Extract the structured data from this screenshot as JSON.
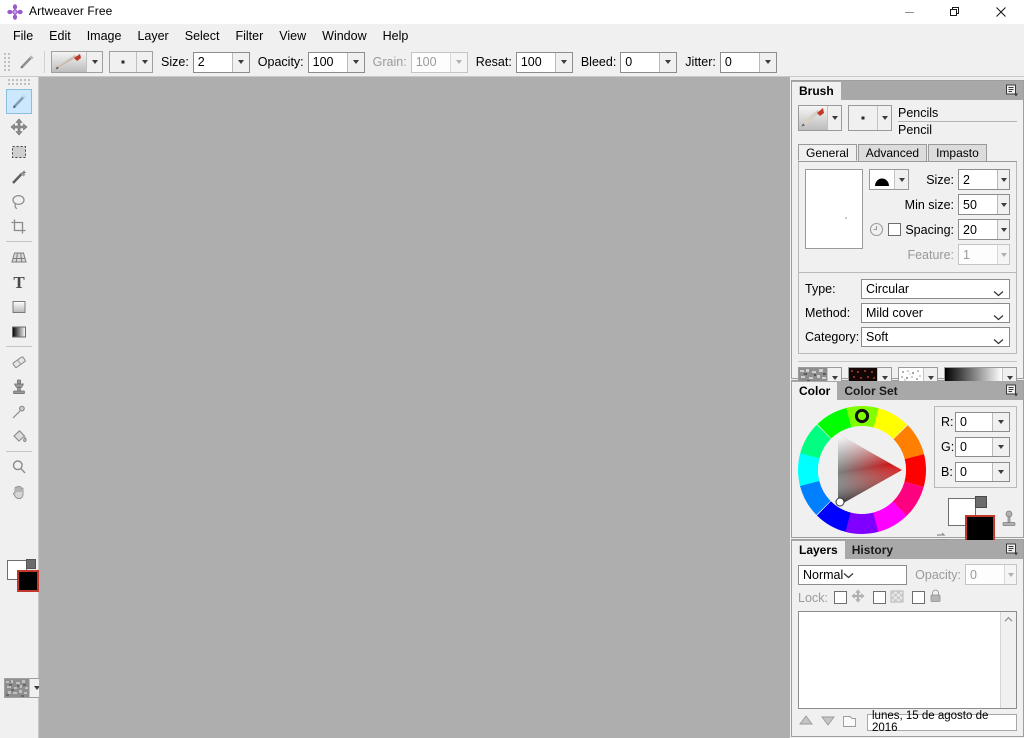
{
  "window": {
    "title": "Artweaver Free",
    "icon": "artweaver-logo-icon",
    "minimize": "minimize-icon",
    "maximize": "restore-icon",
    "close": "close-icon"
  },
  "menubar": {
    "items": [
      {
        "label": "File"
      },
      {
        "label": "Edit"
      },
      {
        "label": "Image"
      },
      {
        "label": "Layer"
      },
      {
        "label": "Select"
      },
      {
        "label": "Filter"
      },
      {
        "label": "View"
      },
      {
        "label": "Window"
      },
      {
        "label": "Help"
      }
    ]
  },
  "options_toolbar": {
    "tool_icon": "pencil-icon",
    "brush_preview": "pencil-brush-preview",
    "tip_preview": "brush-tip-preview",
    "fields": [
      {
        "label": "Size:",
        "value": "2",
        "enabled": true
      },
      {
        "label": "Opacity:",
        "value": "100",
        "enabled": true
      },
      {
        "label": "Grain:",
        "value": "100",
        "enabled": false
      },
      {
        "label": "Resat:",
        "value": "100",
        "enabled": true
      },
      {
        "label": "Bleed:",
        "value": "0",
        "enabled": true
      },
      {
        "label": "Jitter:",
        "value": "0",
        "enabled": true
      }
    ]
  },
  "tools": {
    "items": [
      {
        "name": "brush-tool",
        "icon": "paintbrush-icon",
        "selected": true
      },
      {
        "name": "move-tool",
        "icon": "move-arrows-icon",
        "selected": false
      },
      {
        "name": "rectangle-select-tool",
        "icon": "marquee-icon",
        "selected": false
      },
      {
        "name": "magic-wand-tool",
        "icon": "magic-wand-icon",
        "selected": false
      },
      {
        "name": "lasso-tool",
        "icon": "lasso-icon",
        "selected": false
      },
      {
        "name": "crop-tool",
        "icon": "crop-icon",
        "selected": false
      },
      {
        "name": "perspective-tool",
        "icon": "grid-perspective-icon",
        "selected": false
      },
      {
        "name": "text-tool",
        "icon": "text-t-icon",
        "selected": false
      },
      {
        "name": "shape-tool",
        "icon": "square-shape-icon",
        "selected": false
      },
      {
        "name": "gradient-tool",
        "icon": "gradient-icon",
        "selected": false
      },
      {
        "name": "eraser-tool",
        "icon": "eraser-icon",
        "selected": false
      },
      {
        "name": "clone-stamp-tool",
        "icon": "stamp-icon",
        "selected": false
      },
      {
        "name": "eyedropper-tool",
        "icon": "eyedropper-icon",
        "selected": false
      },
      {
        "name": "paint-bucket-tool",
        "icon": "paint-bucket-icon",
        "selected": false
      },
      {
        "name": "zoom-tool",
        "icon": "magnifier-icon",
        "selected": false
      },
      {
        "name": "hand-tool",
        "icon": "hand-icon",
        "selected": false
      }
    ],
    "foreground_color": "#ffffff",
    "background_color": "#000000",
    "texture_swatch": "gray-noise-texture"
  },
  "canvas": {
    "background_color": "#aeaeae"
  },
  "brush_panel": {
    "tab": "Brush",
    "menu_icon": "panel-menu-icon",
    "category": "Pencils",
    "variant": "Pencil",
    "tabs": [
      {
        "label": "General",
        "selected": true
      },
      {
        "label": "Advanced",
        "selected": false
      },
      {
        "label": "Impasto",
        "selected": false
      }
    ],
    "general": {
      "shape_icon": "dome-brush-shape-icon",
      "clock_icon": "clock-icon",
      "fields": [
        {
          "label": "Size:",
          "value": "2",
          "enabled": true
        },
        {
          "label": "Min size:",
          "value": "50",
          "enabled": true
        },
        {
          "label": "Spacing:",
          "value": "20",
          "enabled": true
        },
        {
          "label": "Feature:",
          "value": "1",
          "enabled": false
        }
      ],
      "selects": [
        {
          "label": "Type:",
          "value": "Circular"
        },
        {
          "label": "Method:",
          "value": "Mild cover"
        },
        {
          "label": "Category:",
          "value": "Soft"
        }
      ],
      "swatches": [
        {
          "name": "paper-texture-swatch",
          "icon": "gray-noise-texture"
        },
        {
          "name": "pattern-swatch",
          "icon": "dark-red-pattern"
        },
        {
          "name": "grain-swatch",
          "icon": "speckle-pattern"
        },
        {
          "name": "gradient-swatch",
          "icon": "black-white-gradient"
        }
      ]
    }
  },
  "color_panel": {
    "tabs": [
      {
        "label": "Color",
        "selected": true
      },
      {
        "label": "Color Set",
        "selected": false
      }
    ],
    "menu_icon": "panel-menu-icon",
    "channels": [
      {
        "label": "R:",
        "value": "0"
      },
      {
        "label": "G:",
        "value": "0"
      },
      {
        "label": "B:",
        "value": "0"
      }
    ],
    "foreground_color": "#ffffff",
    "background_color": "#000000",
    "swap_icon": "swap-colors-icon",
    "clone_color_icon": "clone-color-icon"
  },
  "layers_panel": {
    "tabs": [
      {
        "label": "Layers",
        "selected": true
      },
      {
        "label": "History",
        "selected": false
      }
    ],
    "menu_icon": "panel-menu-icon",
    "blend_mode": "Normal",
    "opacity_label": "Opacity:",
    "opacity_value": "0",
    "lock_label": "Lock:",
    "lock_toggles": [
      {
        "name": "lock-position-checkbox",
        "icon": "move-arrows-icon"
      },
      {
        "name": "lock-pixels-checkbox",
        "icon": "transparency-icon"
      },
      {
        "name": "lock-all-checkbox",
        "icon": "padlock-icon"
      }
    ],
    "footer": {
      "move_up_icon": "arrow-up-icon",
      "move_down_icon": "arrow-down-icon",
      "new_layer_icon": "new-layer-icon",
      "status_text": "lunes, 15 de agosto de 2016"
    }
  }
}
